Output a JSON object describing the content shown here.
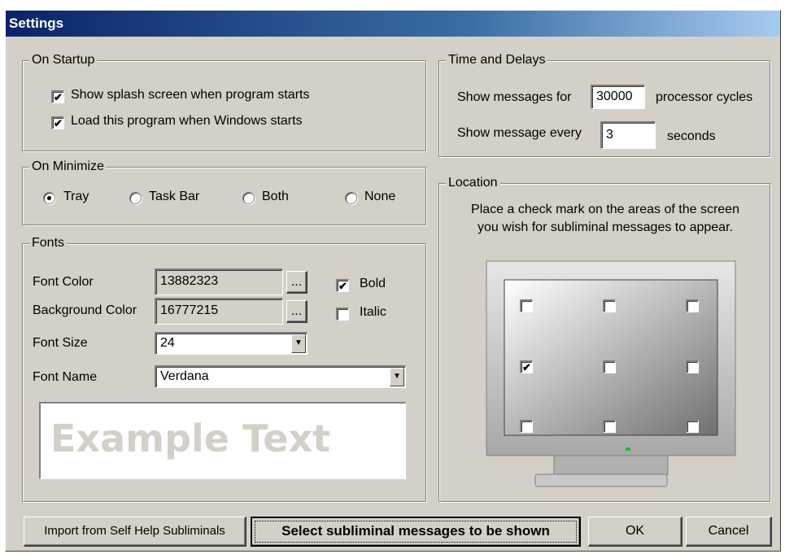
{
  "window": {
    "title": "Settings"
  },
  "startup": {
    "legend": "On Startup",
    "splash": {
      "label": "Show splash screen when program starts",
      "checked": true
    },
    "load": {
      "label": "Load this program when Windows starts",
      "checked": true
    }
  },
  "minimize": {
    "legend": "On Minimize",
    "options": [
      {
        "label": "Tray",
        "selected": true
      },
      {
        "label": "Task Bar",
        "selected": false
      },
      {
        "label": "Both",
        "selected": false
      },
      {
        "label": "None",
        "selected": false
      }
    ]
  },
  "fonts": {
    "legend": "Fonts",
    "font_color_label": "Font Color",
    "font_color_value": "13882323",
    "bg_color_label": "Background Color",
    "bg_color_value": "16777215",
    "browse_label": "...",
    "font_size_label": "Font Size",
    "font_size_value": "24",
    "font_name_label": "Font Name",
    "font_name_value": "Verdana",
    "bold": {
      "label": "Bold",
      "checked": true
    },
    "italic": {
      "label": "Italic",
      "checked": false
    },
    "example_text": "Example Text"
  },
  "time": {
    "legend": "Time and Delays",
    "show_for_label": "Show messages for",
    "show_for_value": "30000",
    "show_for_unit": "processor cycles",
    "every_label": "Show message every",
    "every_value": "3",
    "every_unit": "seconds"
  },
  "location": {
    "legend": "Location",
    "instruction_line1": "Place a check mark on the areas of the screen",
    "instruction_line2": "you wish for subliminal messages to appear.",
    "grid": [
      false,
      false,
      false,
      true,
      false,
      false,
      false,
      false,
      false
    ]
  },
  "buttons": {
    "import": "Import from Self Help Subliminals",
    "select": "Select subliminal messages to be shown",
    "ok": "OK",
    "cancel": "Cancel"
  },
  "icons": {
    "check": "check-mark",
    "dropdown": "down-triangle"
  }
}
